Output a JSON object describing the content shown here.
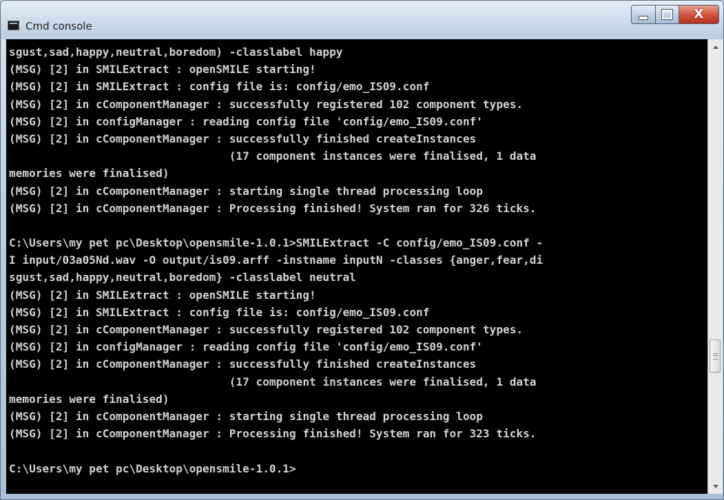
{
  "window": {
    "title": "Cmd console",
    "close_glyph": "X"
  },
  "icons": {
    "app": "console-app-icon",
    "minimize": "minimize-icon",
    "maximize": "maximize-icon",
    "close": "close-icon",
    "scroll_up": "scroll-up-arrow-icon",
    "scroll_down": "scroll-down-arrow-icon"
  },
  "console": {
    "lines": [
      "sgust,sad,happy,neutral,boredom) -classlabel happy",
      "(MSG) [2] in SMILExtract : openSMILE starting!",
      "(MSG) [2] in SMILExtract : config file is: config/emo_IS09.conf",
      "(MSG) [2] in cComponentManager : successfully registered 102 component types.",
      "(MSG) [2] in configManager : reading config file 'config/emo_IS09.conf'",
      "(MSG) [2] in cComponentManager : successfully finished createInstances",
      "                                 (17 component instances were finalised, 1 data",
      "memories were finalised)",
      "(MSG) [2] in cComponentManager : starting single thread processing loop",
      "(MSG) [2] in cComponentManager : Processing finished! System ran for 326 ticks.",
      "",
      "C:\\Users\\my pet pc\\Desktop\\opensmile-1.0.1>SMILExtract -C config/emo_IS09.conf -",
      "I input/03a05Nd.wav -O output/is09.arff -instname inputN -classes {anger,fear,di",
      "sgust,sad,happy,neutral,boredom} -classlabel neutral",
      "(MSG) [2] in SMILExtract : openSMILE starting!",
      "(MSG) [2] in SMILExtract : config file is: config/emo_IS09.conf",
      "(MSG) [2] in cComponentManager : successfully registered 102 component types.",
      "(MSG) [2] in configManager : reading config file 'config/emo_IS09.conf'",
      "(MSG) [2] in cComponentManager : successfully finished createInstances",
      "                                 (17 component instances were finalised, 1 data",
      "memories were finalised)",
      "(MSG) [2] in cComponentManager : starting single thread processing loop",
      "(MSG) [2] in cComponentManager : Processing finished! System ran for 323 ticks.",
      "",
      "C:\\Users\\my pet pc\\Desktop\\opensmile-1.0.1>"
    ]
  },
  "colors": {
    "console_background": "#000000",
    "console_text": "#d4d4d4",
    "close_button": "#c8452c"
  }
}
